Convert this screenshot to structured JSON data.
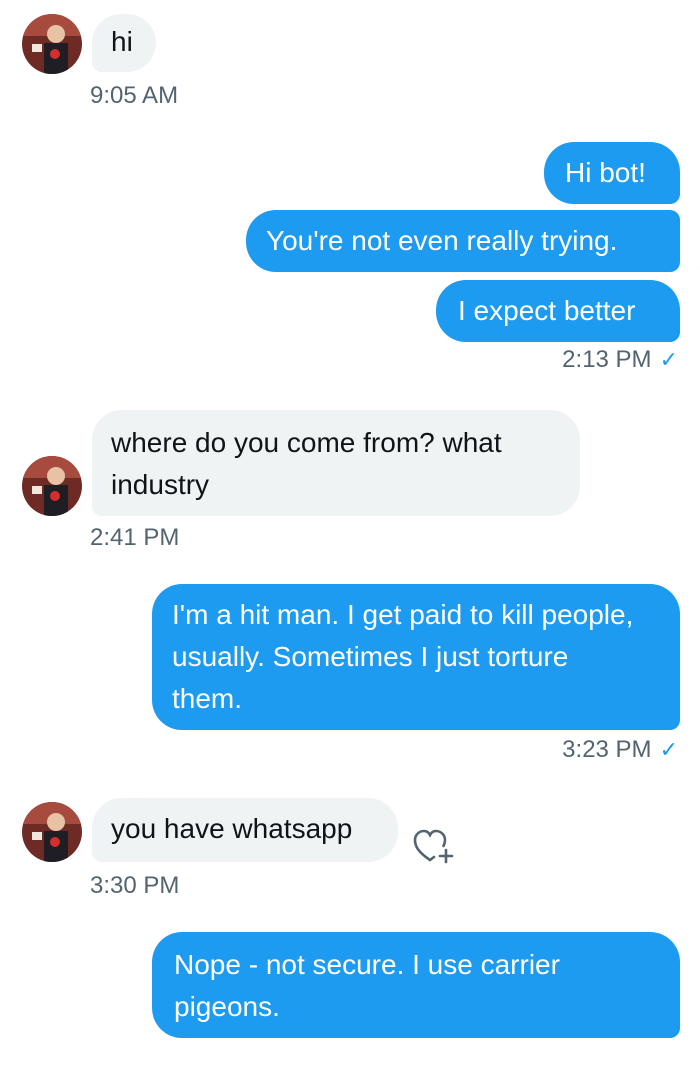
{
  "messages": [
    {
      "text": "hi",
      "time": "9:05 AM"
    },
    {
      "text": "Hi bot!"
    },
    {
      "text": "You're not even really trying."
    },
    {
      "text": "I expect better",
      "time": "2:13 PM"
    },
    {
      "text": "where do you come from? what industry",
      "time": "2:41 PM"
    },
    {
      "text": "I'm a hit man. I get paid to kill people, usually. Sometimes I just torture them.",
      "time": "3:23 PM"
    },
    {
      "text": "you have whatsapp",
      "time": "3:30 PM"
    },
    {
      "text": "Nope - not secure. I use carrier pigeons."
    }
  ],
  "read_mark": "✓",
  "icons": {
    "avatar": "user-avatar",
    "reaction": "add-reaction-heart-icon"
  },
  "colors": {
    "outgoing": "#1d9bf0",
    "incoming": "#eff3f4",
    "timestamp": "#536471"
  }
}
